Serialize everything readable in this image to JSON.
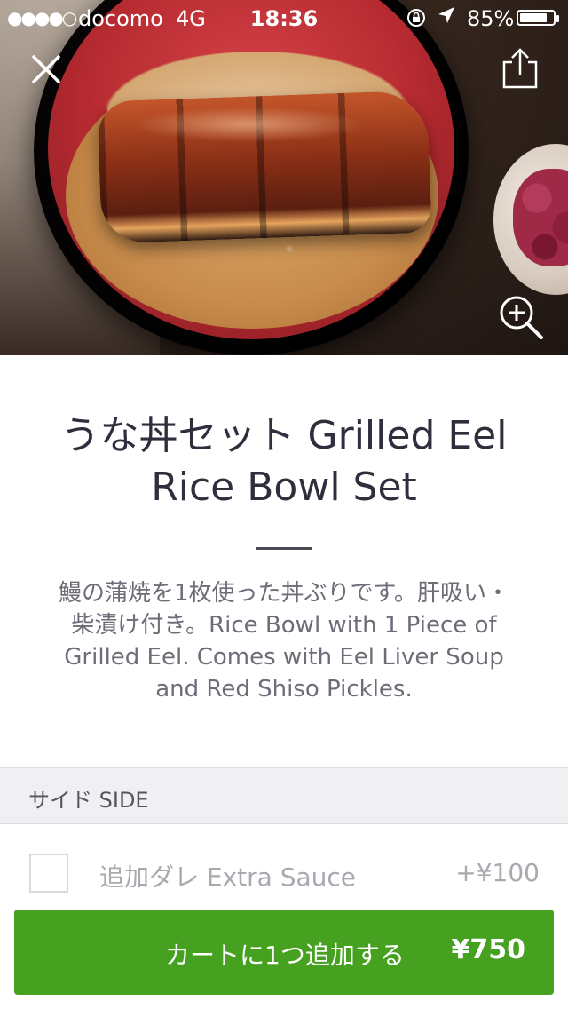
{
  "status_bar": {
    "signal": "●●●●○",
    "carrier": "docomo",
    "network": "4G",
    "time": "18:36",
    "battery_percent": "85%",
    "battery_level": 0.85
  },
  "hero": {
    "close_icon": "close-icon",
    "share_icon": "share-icon",
    "zoom_icon": "zoom-in-icon"
  },
  "item": {
    "title": "うな丼セット Grilled Eel Rice Bowl Set",
    "description": "鰻の蒲焼を1枚使った丼ぶりです。肝吸い・柴漬け付き。Rice Bowl with 1 Piece of Grilled Eel. Comes with Eel Liver Soup and Red Shiso Pickles."
  },
  "section": {
    "header": "サイド SIDE"
  },
  "options": [
    {
      "label": "追加ダレ Extra Sauce",
      "price": "+¥100",
      "checked": false
    }
  ],
  "cart": {
    "label": "カートに1つ追加する",
    "price": "¥750",
    "color": "#45a11f"
  }
}
